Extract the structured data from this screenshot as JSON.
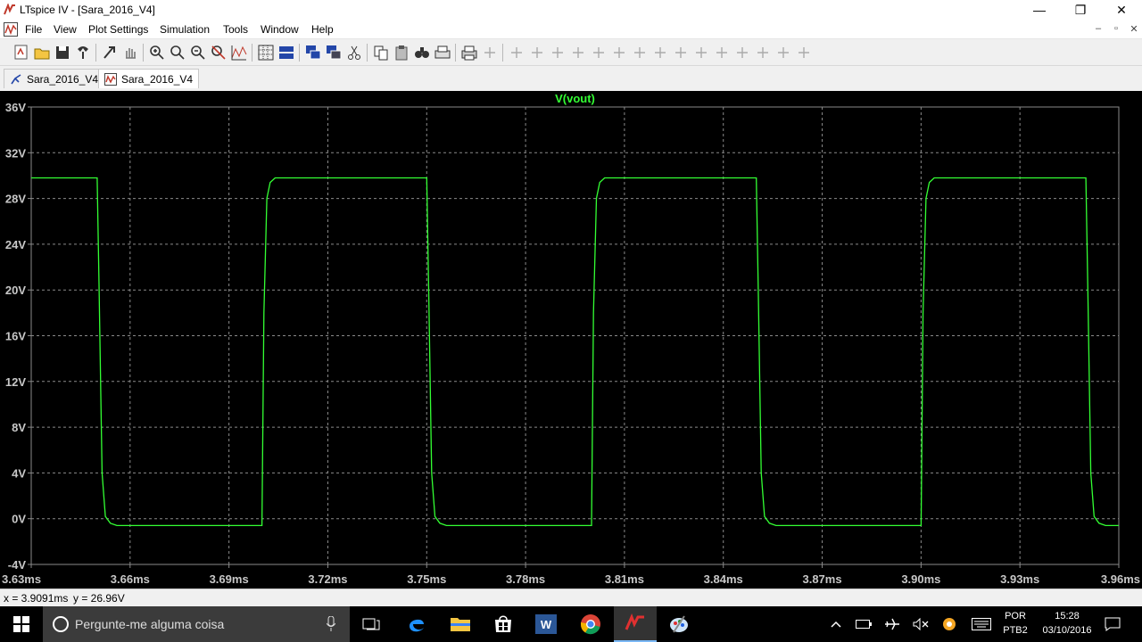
{
  "window": {
    "title": "LTspice IV - [Sara_2016_V4]",
    "minimize_glyph": "—",
    "maximize_glyph": "❐",
    "close_glyph": "✕"
  },
  "menu": {
    "items": [
      "File",
      "View",
      "Plot Settings",
      "Simulation",
      "Tools",
      "Window",
      "Help"
    ],
    "mdi_controls": [
      "–",
      "▫",
      "✕"
    ]
  },
  "toolbar": {
    "icons": [
      "new-schematic-icon",
      "open-icon",
      "save-icon",
      "control-panel-icon",
      "run-icon",
      "pan-icon",
      "zoom-in-icon",
      "zoom-area-icon",
      "zoom-out-icon",
      "zoom-cancel-icon",
      "autorange-icon",
      "grid-icon",
      "tile-horizontal-icon",
      "cascade-icon",
      "tile-vertical-icon",
      "cut-icon",
      "copy-icon",
      "paste-icon",
      "find-icon",
      "print-setup-icon",
      "print-icon",
      "wire-icon",
      "ground-icon",
      "label-icon",
      "resistor-icon",
      "capacitor-icon",
      "inductor-icon",
      "diode-icon",
      "component-icon",
      "move-icon",
      "drag-icon",
      "undo-icon",
      "redo-icon",
      "rotate-icon",
      "mirror-icon",
      "text-icon",
      "spice-directive-icon"
    ]
  },
  "tabs": [
    {
      "label": "Sara_2016_V4",
      "icon": "schematic-icon",
      "active": false
    },
    {
      "label": "Sara_2016_V4",
      "icon": "waveform-icon",
      "active": true
    }
  ],
  "status": {
    "x_readout": "x = 3.9091ms",
    "y_readout": "y = 26.96V"
  },
  "colors": {
    "trace": "#33ff33",
    "plot_background": "#000000",
    "grid": "#8a8a8a",
    "axis_text": "#c8c8c8"
  },
  "taskbar": {
    "search_placeholder": "Pergunte-me alguma coisa",
    "language": "POR",
    "keyboard": "PTB2",
    "time": "15:28",
    "date": "03/10/2016",
    "apps": [
      "task-view-icon",
      "edge-icon",
      "file-explorer-icon",
      "store-icon",
      "word-icon",
      "chrome-icon",
      "ltspice-icon",
      "paint-icon"
    ]
  },
  "chart_data": {
    "type": "line",
    "title": "V(vout)",
    "xlabel": "",
    "ylabel": "",
    "xlim": [
      3.63,
      3.96
    ],
    "ylim": [
      -4,
      36
    ],
    "x_unit": "ms",
    "y_unit": "V",
    "grid": true,
    "x_ticks": [
      "3.63ms",
      "3.66ms",
      "3.69ms",
      "3.72ms",
      "3.75ms",
      "3.78ms",
      "3.81ms",
      "3.84ms",
      "3.87ms",
      "3.90ms",
      "3.93ms",
      "3.96ms"
    ],
    "y_ticks": [
      "36V",
      "32V",
      "28V",
      "24V",
      "20V",
      "16V",
      "12V",
      "8V",
      "4V",
      "0V",
      "-4V"
    ],
    "series": [
      {
        "name": "V(vout)",
        "x": [
          3.63,
          3.65,
          3.6506,
          3.6515,
          3.6525,
          3.654,
          3.656,
          3.7,
          3.7006,
          3.7015,
          3.7025,
          3.704,
          3.75,
          3.7506,
          3.7515,
          3.7525,
          3.754,
          3.756,
          3.8,
          3.8006,
          3.8015,
          3.8025,
          3.804,
          3.85,
          3.8506,
          3.8515,
          3.8525,
          3.854,
          3.856,
          3.9,
          3.9006,
          3.9015,
          3.9025,
          3.904,
          3.95,
          3.9506,
          3.9515,
          3.9525,
          3.954,
          3.956,
          3.96
        ],
        "y": [
          29.8,
          29.8,
          20.0,
          4.0,
          0.2,
          -0.4,
          -0.6,
          -0.6,
          18.0,
          28.0,
          29.4,
          29.8,
          29.8,
          20.0,
          4.0,
          0.2,
          -0.4,
          -0.6,
          -0.6,
          18.0,
          28.0,
          29.4,
          29.8,
          29.8,
          20.0,
          4.0,
          0.2,
          -0.4,
          -0.6,
          -0.6,
          18.0,
          28.0,
          29.4,
          29.8,
          29.8,
          20.0,
          4.0,
          0.2,
          -0.4,
          -0.6,
          -0.6
        ]
      }
    ]
  }
}
